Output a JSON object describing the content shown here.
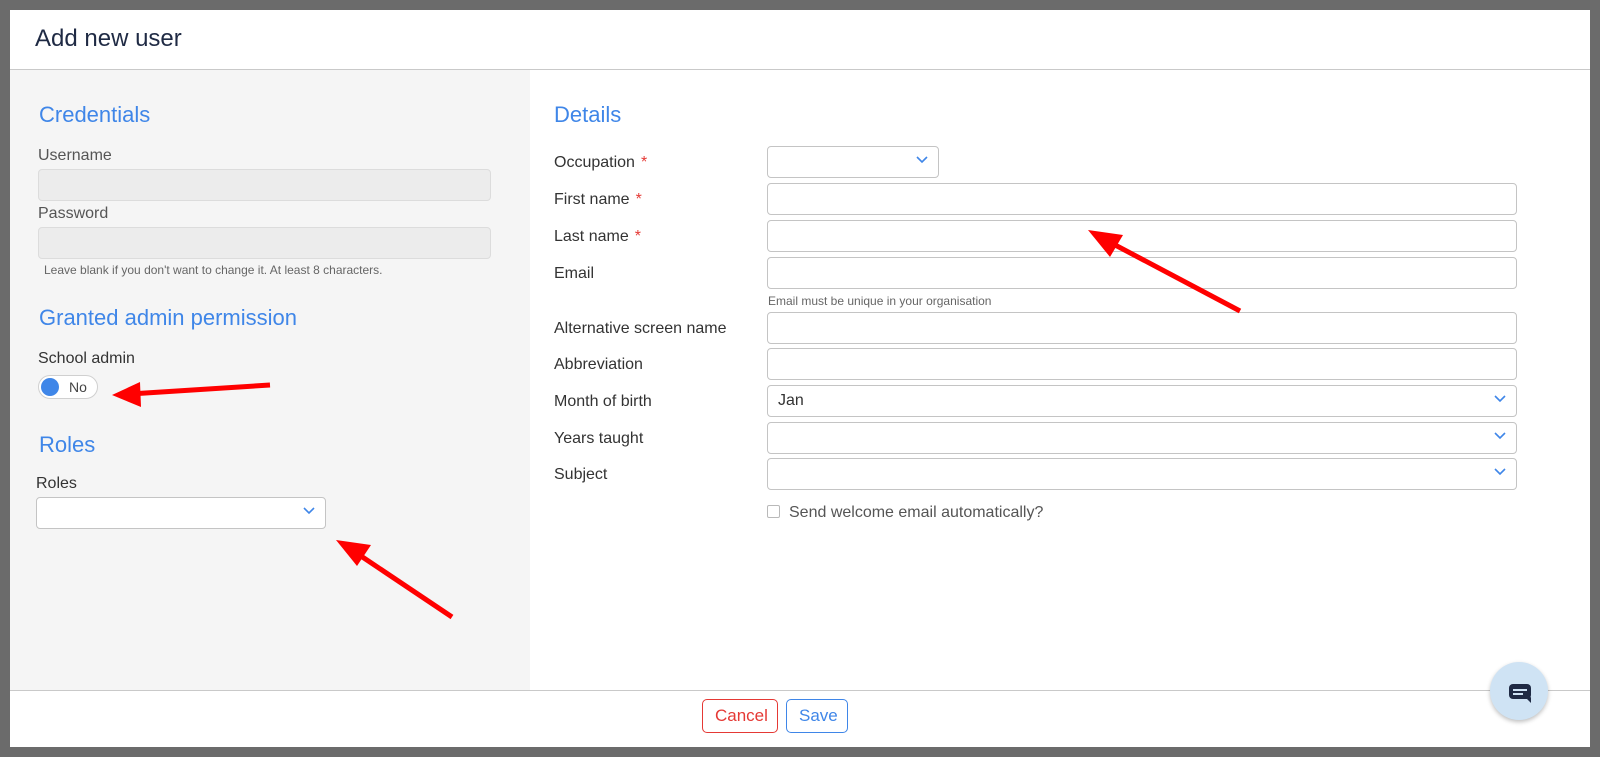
{
  "modal": {
    "title": "Add new user"
  },
  "credentials": {
    "title": "Credentials",
    "username_label": "Username",
    "username_value": "",
    "password_label": "Password",
    "password_value": "",
    "password_help": "Leave blank if you don't want to change it. At least 8 characters."
  },
  "admin": {
    "title": "Granted admin permission",
    "school_admin_label": "School admin",
    "school_admin_value": "No"
  },
  "roles": {
    "title": "Roles",
    "label": "Roles",
    "value": ""
  },
  "details": {
    "title": "Details",
    "required_marker": "*",
    "occupation_label": "Occupation",
    "occupation_value": "",
    "first_name_label": "First name",
    "first_name_value": "",
    "last_name_label": "Last name",
    "last_name_value": "",
    "email_label": "Email",
    "email_value": "",
    "email_help": "Email must be unique in your organisation",
    "alt_screen_name_label": "Alternative screen name",
    "alt_screen_name_value": "",
    "abbreviation_label": "Abbreviation",
    "abbreviation_value": "",
    "month_of_birth_label": "Month of birth",
    "month_of_birth_value": "Jan",
    "years_taught_label": "Years taught",
    "years_taught_value": "",
    "subject_label": "Subject",
    "subject_value": "",
    "welcome_email_label": "Send welcome email automatically?",
    "welcome_email_checked": false
  },
  "footer": {
    "cancel_label": "Cancel",
    "save_label": "Save"
  },
  "icons": {
    "dropdown": "chevron-down-icon",
    "chat": "chat-icon",
    "annotation": "red-arrow"
  },
  "colors": {
    "accent": "#3f86e8",
    "danger": "#e53935",
    "annotation": "#ff0000"
  }
}
